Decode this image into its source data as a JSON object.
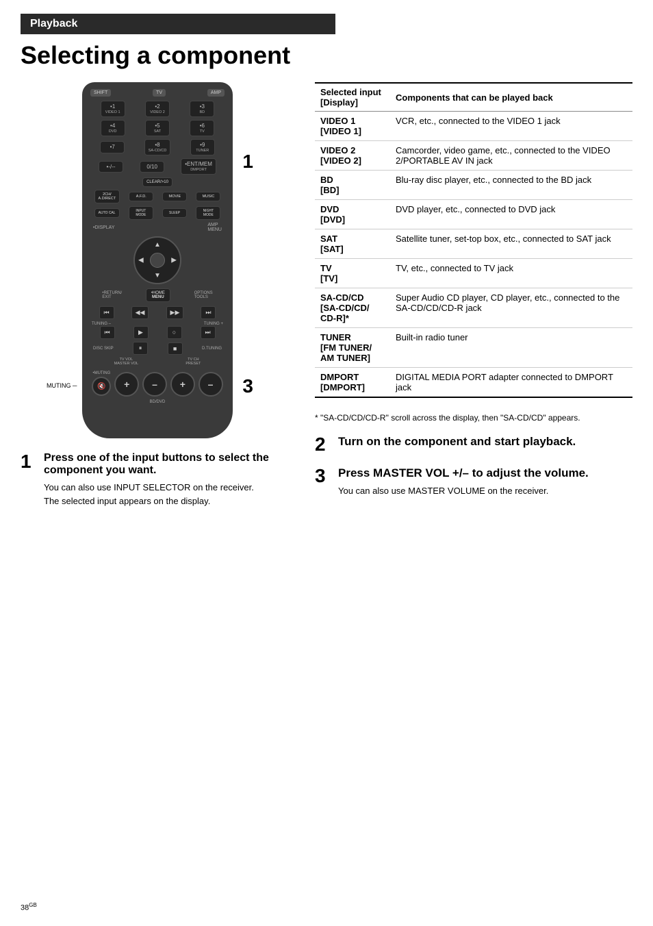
{
  "header": {
    "section_label": "Playback",
    "page_title": "Selecting a component"
  },
  "remote": {
    "top_buttons": [
      "SHIFT",
      "TV",
      "AMP"
    ],
    "rows": [
      [
        {
          "dot": "•1",
          "sub": "VIDEO 1"
        },
        {
          "dot": "•2",
          "sub": "VIDEO 2"
        },
        {
          "dot": "•3",
          "sub": "BD"
        }
      ],
      [
        {
          "dot": "•4",
          "sub": "DVD"
        },
        {
          "dot": "•5",
          "sub": "SAT"
        },
        {
          "dot": "•6",
          "sub": "TV"
        }
      ],
      [
        {
          "dot": "•7",
          "sub": ""
        },
        {
          "dot": "•8",
          "sub": "SA-CD/CD"
        },
        {
          "dot": "•9",
          "sub": "TUNER"
        }
      ],
      [
        {
          "dot": "•-/--",
          "sub": ""
        },
        {
          "dot": "0/10",
          "sub": ""
        },
        {
          "dot": "•ENT/MEM",
          "sub": "DMPORT"
        }
      ]
    ],
    "function_row": [
      "2CH/A.DIRECT",
      "A.F.D.",
      "MOVIE",
      "MUSIC"
    ],
    "function_row2": [
      "AUTO CAL",
      "INPUT MODE",
      "SLEEP",
      "NIGHT MODE"
    ],
    "display_label": "•DISPLAY",
    "amp_menu_label": "AMP MENU",
    "return_label": "•RETURN/EXIT",
    "home_label": "•HOME MENU",
    "options_tools_label": "OPTIONS TOOLS",
    "transport": [
      "⏮",
      "◀",
      "▶",
      "⏭"
    ],
    "transport2": [
      "⏮",
      "▶",
      "○",
      "⏭"
    ],
    "disc_skip_label": "DISC SKIP",
    "d_tuning_label": "D.TUNING",
    "tv_vol_label": "TV VOL MASTER VOL",
    "tv_ch_label": "TV CH PRESET",
    "muting_label": "MUTING",
    "vol_plus": "+",
    "vol_minus": "–"
  },
  "table": {
    "col1_header": "Selected input [Display]",
    "col2_header": "Components that can be played back",
    "rows": [
      {
        "input": "VIDEO 1\n[VIDEO 1]",
        "component": "VCR, etc., connected to the VIDEO 1 jack"
      },
      {
        "input": "VIDEO 2\n[VIDEO 2]",
        "component": "Camcorder, video game, etc., connected to the VIDEO 2/PORTABLE AV IN jack"
      },
      {
        "input": "BD\n[BD]",
        "component": "Blu-ray disc player, etc., connected to the BD jack"
      },
      {
        "input": "DVD\n[DVD]",
        "component": "DVD player, etc., connected to DVD jack"
      },
      {
        "input": "SAT\n[SAT]",
        "component": "Satellite tuner, set-top box, etc., connected to SAT jack"
      },
      {
        "input": "TV\n[TV]",
        "component": "TV, etc., connected to TV jack"
      },
      {
        "input": "SA-CD/CD\n[SA-CD/CD/\nCD-R]*",
        "component": "Super Audio CD player, CD player, etc., connected to the SA-CD/CD/CD-R jack"
      },
      {
        "input": "TUNER\n[FM TUNER/\nAM TUNER]",
        "component": "Built-in radio tuner"
      },
      {
        "input": "DMPORT\n[DMPORT]",
        "component": "DIGITAL MEDIA PORT adapter connected to DMPORT jack"
      }
    ]
  },
  "footnote": "* \"SA-CD/CD/CD-R\" scroll across the display, then \"SA-CD/CD\" appears.",
  "steps": [
    {
      "num": "1",
      "title": "Press one of the input buttons to select the component you want.",
      "desc": [
        "You can also use INPUT SELECTOR on the receiver.",
        "The selected input appears on the display."
      ]
    },
    {
      "num": "2",
      "title": "Turn on the component and start playback.",
      "desc": []
    },
    {
      "num": "3",
      "title": "Press MASTER VOL +/– to adjust the volume.",
      "desc": [
        "You can also use MASTER VOLUME on the receiver."
      ]
    }
  ],
  "page_number": "38",
  "page_number_sup": "GB"
}
